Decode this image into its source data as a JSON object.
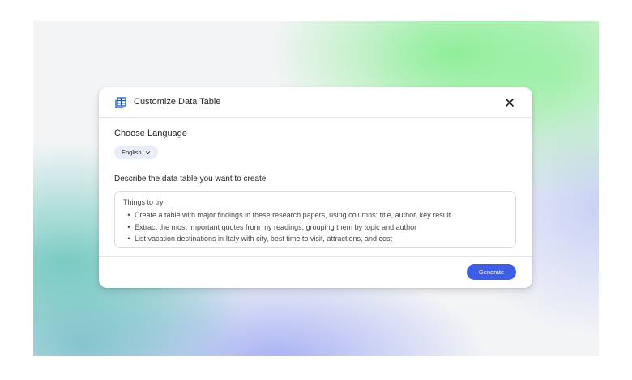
{
  "dialog": {
    "title": "Customize Data Table",
    "title_icon": "table-icon",
    "close_icon": "close-icon"
  },
  "language": {
    "label": "Choose Language",
    "selected": "English",
    "dropdown_icon": "chevron-down-icon"
  },
  "prompt": {
    "label": "Describe the data table you want to create",
    "hint_title": "Things to try",
    "bullet": "•",
    "suggestions": [
      "Create a table with major findings in these research papers, using columns: title, author, key result",
      "Extract the most important quotes from my readings, grouping them by topic and author",
      "List vacation destinations in Italy with city, best time to visit, attractions, and cost"
    ]
  },
  "footer": {
    "generate_label": "Generate"
  },
  "colors": {
    "accent": "#3f5ee8",
    "chip_bg": "#e9eef6",
    "icon_blue": "#1a56c4"
  }
}
